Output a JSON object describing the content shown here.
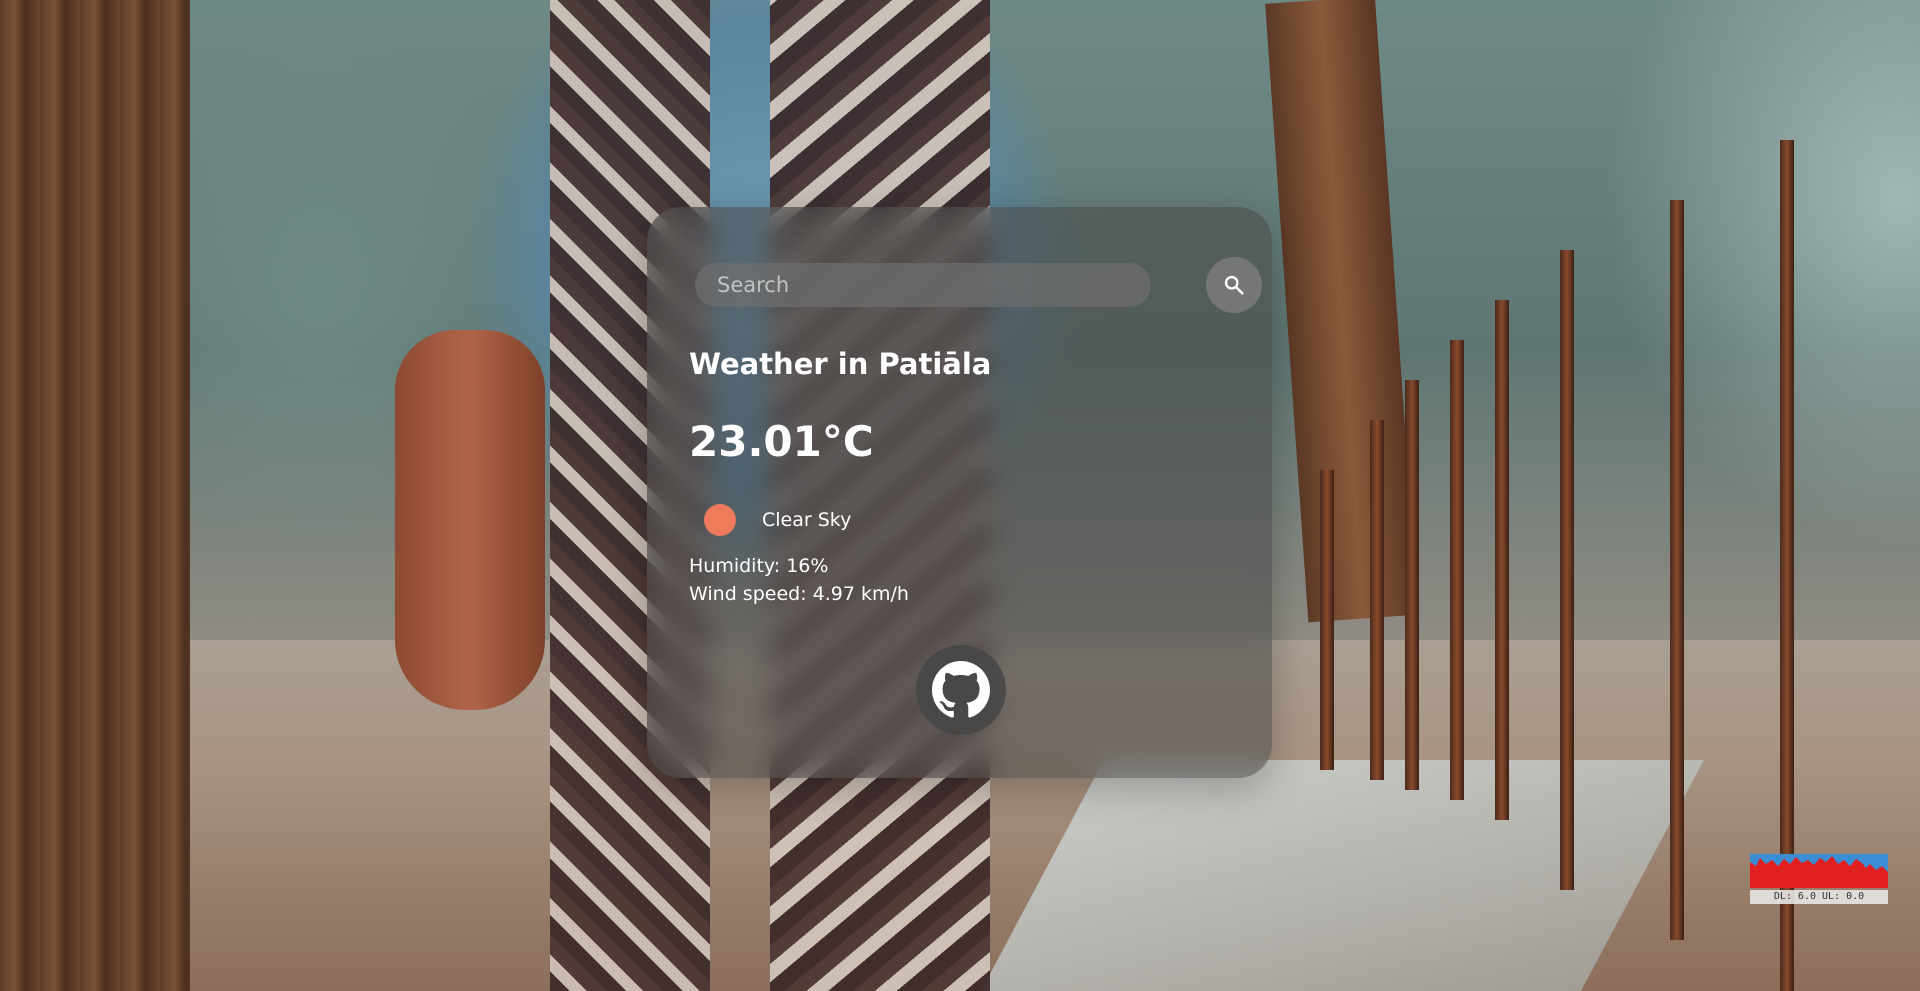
{
  "search": {
    "placeholder": "Search",
    "value": "",
    "button_icon": "search-icon"
  },
  "weather": {
    "title": "Weather in Patiāla",
    "temperature": "23.01°C",
    "condition": "Clear Sky",
    "condition_icon": "sun-icon",
    "humidity": "Humidity: 16%",
    "wind": "Wind speed: 4.97 km/h"
  },
  "footer": {
    "link_icon": "github-icon"
  },
  "perf_widget": {
    "label": "DL: 6.0 UL: 0.0"
  },
  "colors": {
    "card_bg": "#464646",
    "text": "#ffffff",
    "sun": "#f07a5c",
    "search_bg": "#6e6e6e"
  }
}
